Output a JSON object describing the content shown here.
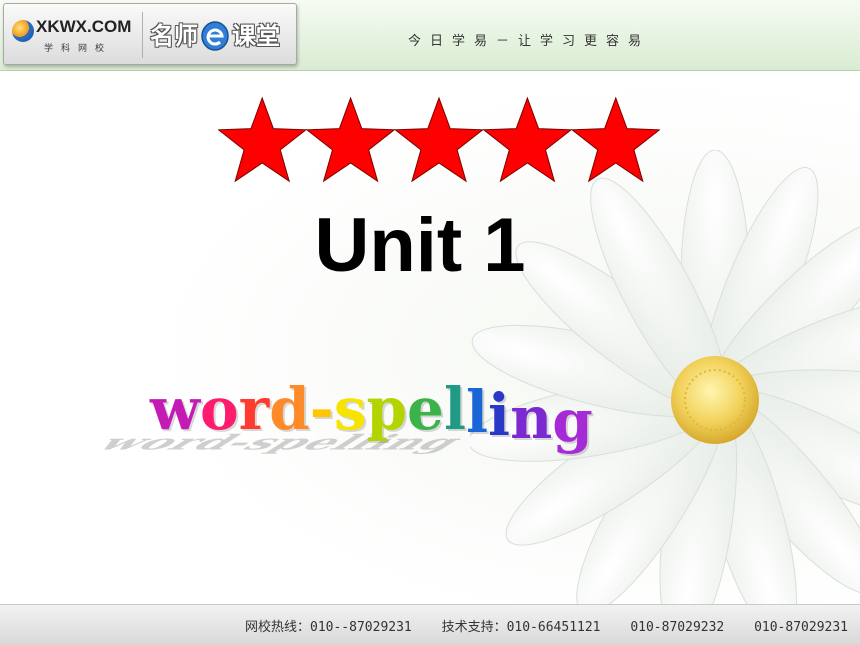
{
  "header": {
    "logo_main": "XKWX.COM",
    "logo_sub": "学科网校",
    "brand_left": "名师",
    "brand_right": "课堂",
    "tagline": "今日学易－让学习更容易"
  },
  "slide": {
    "star_count": 5,
    "star_color": "#ff0000",
    "title": "Unit 1",
    "wordart": "word-spelling",
    "wordart_colors": [
      "#c41bb5",
      "#ff1c6e",
      "#ff3b2f",
      "#ff8a2a",
      "#ffc600",
      "#f6e300",
      "#b4d400",
      "#3bb34a",
      "#1f9a84",
      "#1a66d6",
      "#2a38c8",
      "#7a2ad0",
      "#a62bd6"
    ]
  },
  "footer": {
    "hotline": "网校热线：010--87029231",
    "support": "技术支持：010-66451121",
    "phone2": "010-87029232",
    "phone3": "010-87029231"
  }
}
